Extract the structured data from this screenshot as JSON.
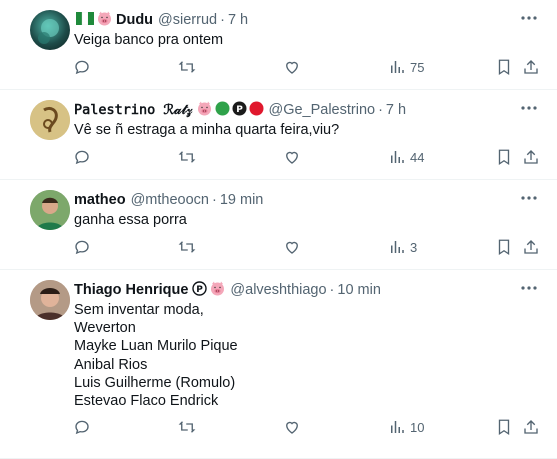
{
  "colors": {
    "text": "#0f1419",
    "muted": "#536471",
    "divider": "#eff3f4",
    "accent_green": "#2fa24a",
    "accent_red": "#e0182d"
  },
  "tweets": [
    {
      "name": "Dudu",
      "handle": "@sierrud",
      "time": "7 h",
      "badges": [
        "nigeria-flag-icon",
        "pig-icon"
      ],
      "body": [
        "Veiga banco pra ontem"
      ],
      "views": "75"
    },
    {
      "name": "𝙿𝚊𝚕𝚎𝚜𝚝𝚛𝚒𝚗𝚘 ℛ𝒶𝓉𝓏",
      "handle": "@Ge_Palestrino",
      "time": "7 h",
      "badges": [
        "pig-icon",
        "green-circle-icon",
        "p-badge-icon",
        "red-circle-icon"
      ],
      "body": [
        "Vê se ñ estraga a minha quarta feira,viu?"
      ],
      "views": "44"
    },
    {
      "name": "matheo",
      "handle": "@mtheoocn",
      "time": "19 min",
      "badges": [],
      "body": [
        "ganha essa porra"
      ],
      "views": "3"
    },
    {
      "name": "Thiago Henrique",
      "handle": "@alveshthiago",
      "time": "10 min",
      "badges": [
        "p-circled-icon",
        "pig-icon"
      ],
      "body": [
        "Sem inventar moda,",
        "Weverton",
        "Mayke Luan Murilo Pique",
        "Anibal Rios",
        "Luis Guilherme (Romulo)",
        "Estevao Flaco Endrick"
      ],
      "views": "10"
    }
  ]
}
